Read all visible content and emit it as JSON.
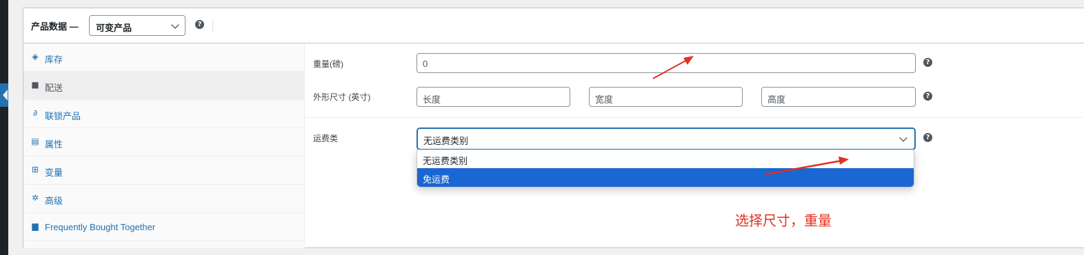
{
  "panel": {
    "title": "产品数据 —",
    "product_type": "可变产品",
    "help_icon": "question-circle-icon"
  },
  "tabs": [
    {
      "label": "库存",
      "icon": "tag-icon",
      "glyph": "◈"
    },
    {
      "label": "配送",
      "icon": "truck-icon",
      "glyph": "■",
      "active": true
    },
    {
      "label": "联锁产品",
      "icon": "link-icon",
      "glyph": "∂"
    },
    {
      "label": "属性",
      "icon": "list-view-icon",
      "glyph": "▤"
    },
    {
      "label": "变量",
      "icon": "grid-icon",
      "glyph": "⊞"
    },
    {
      "label": "高级",
      "icon": "gear-icon",
      "glyph": "✲"
    },
    {
      "label": "Frequently Bought Together",
      "icon": "lock-bag-icon",
      "glyph": "▆"
    }
  ],
  "shipping": {
    "weight_label": "重量(磅)",
    "weight_value": "0",
    "dimensions_label": "外形尺寸 (英寸)",
    "length_placeholder": "长度",
    "width_placeholder": "宽度",
    "height_placeholder": "高度",
    "class_label": "运费类",
    "class_value": "无运费类别",
    "class_options": [
      {
        "label": "无运费类别",
        "selected": false
      },
      {
        "label": "免运费",
        "selected": true
      }
    ]
  },
  "annotation": {
    "text": "选择尺寸，重量",
    "color": "#e3301f"
  },
  "colors": {
    "link": "#2271b1",
    "selected_option": "#1a66d2",
    "annotation": "#e3301f"
  }
}
